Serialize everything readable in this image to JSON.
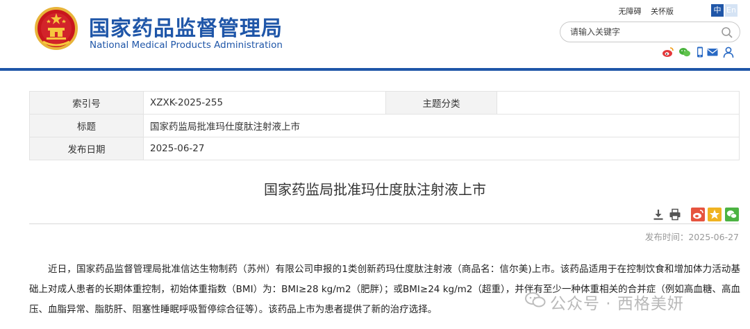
{
  "header": {
    "site_name_cn": "国家药品监督管理局",
    "site_name_en": "National Medical Products Administration",
    "links": {
      "accessibility": "无障碍",
      "care_mode": "关怀版"
    },
    "lang": {
      "zh": "中",
      "en": "En"
    },
    "search": {
      "placeholder": "请输入关键字"
    },
    "social_icons": [
      "weibo-icon",
      "wechat-icon",
      "mobile-icon",
      "mail-icon",
      "user-icon"
    ],
    "brand_color": "#1f56a8"
  },
  "info_table": {
    "rows": [
      {
        "label": "索引号",
        "value": "XZXK-2025-255",
        "label2": "主题分类",
        "value2": ""
      },
      {
        "label": "标题",
        "value": "国家药监局批准玛仕度肽注射液上市"
      },
      {
        "label": "发布日期",
        "value": "2025-06-27"
      }
    ]
  },
  "article": {
    "title": "国家药监局批准玛仕度肽注射液上市",
    "publish_time": "发布时间：2025-06-27",
    "tools": [
      "download-icon",
      "print-icon",
      "share-weibo-icon",
      "favorite-icon",
      "share-wechat-icon"
    ],
    "body": "近日，国家药品监督管理局批准信达生物制药（苏州）有限公司申报的1类创新药玛仕度肽注射液（商品名：信尔美)上市。该药品适用于在控制饮食和增加体力活动基础上对成人患者的长期体重控制，初始体重指数（BMI）为：BMI≥28 kg/m2（肥胖）；或BMI≥24 kg/m2（超重），并伴有至少一种体重相关的合并症（例如高血糖、高血压、血脂异常、脂肪肝、阻塞性睡眠呼吸暂停综合征等）。该药品上市为患者提供了新的治疗选择。"
  },
  "watermark": {
    "text": "公众号 · 西格美妍"
  }
}
